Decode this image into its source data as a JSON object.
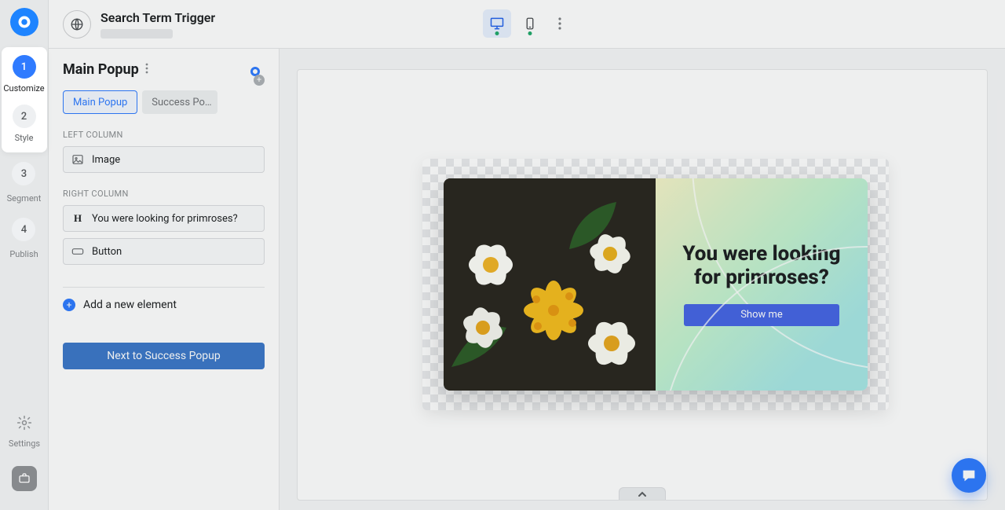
{
  "header": {
    "title": "Search Term Trigger"
  },
  "rail": {
    "steps": [
      {
        "num": "1",
        "label": "Customize",
        "active": true
      },
      {
        "num": "2",
        "label": "Style",
        "active": false
      },
      {
        "num": "3",
        "label": "Segment",
        "active": false
      },
      {
        "num": "4",
        "label": "Publish",
        "active": false
      }
    ],
    "settings_label": "Settings"
  },
  "panel": {
    "title": "Main Popup",
    "tabs": [
      {
        "label": "Main Popup",
        "selected": true
      },
      {
        "label": "Success Po…",
        "selected": false
      }
    ],
    "left_label": "LEFT COLUMN",
    "right_label": "RIGHT COLUMN",
    "left_elements": [
      {
        "kind": "image",
        "label": "Image"
      }
    ],
    "right_elements": [
      {
        "kind": "heading",
        "label": "You were looking for primroses?"
      },
      {
        "kind": "button",
        "label": "Button"
      }
    ],
    "add_label": "Add a new element",
    "next_label": "Next to Success Popup"
  },
  "popup": {
    "heading": "You were looking for primroses?",
    "button_label": "Show me"
  },
  "colors": {
    "accent": "#2f7bff",
    "popup_button": "#4666e5"
  }
}
